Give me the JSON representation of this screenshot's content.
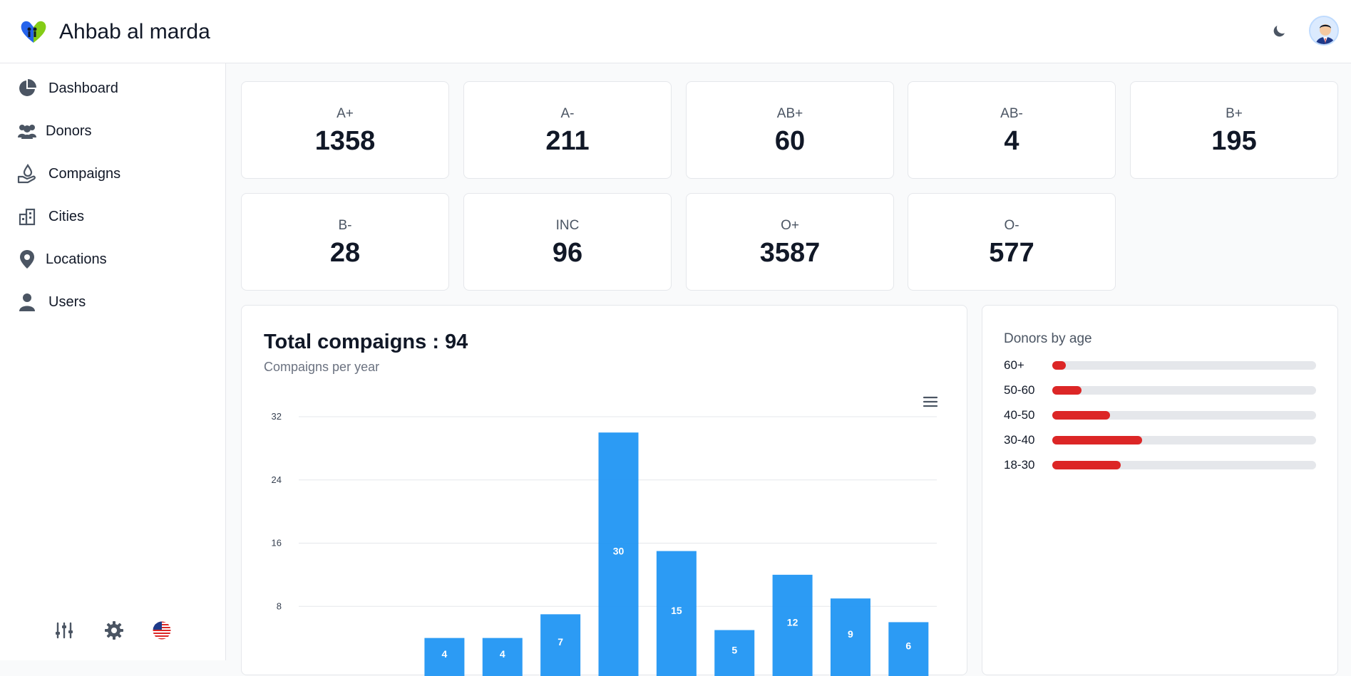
{
  "app": {
    "title": "Ahbab al marda"
  },
  "sidebar": {
    "items": [
      {
        "label": "Dashboard",
        "icon": "pie-chart-icon"
      },
      {
        "label": "Donors",
        "icon": "users-icon"
      },
      {
        "label": "Compaigns",
        "icon": "hand-drop-icon"
      },
      {
        "label": "Cities",
        "icon": "city-icon"
      },
      {
        "label": "Locations",
        "icon": "map-pin-icon"
      },
      {
        "label": "Users",
        "icon": "user-icon"
      }
    ],
    "bottom": [
      "sliders-icon",
      "gear-icon",
      "us-flag-icon"
    ]
  },
  "stats": [
    {
      "label": "A+",
      "value": "1358"
    },
    {
      "label": "A-",
      "value": "211"
    },
    {
      "label": "AB+",
      "value": "60"
    },
    {
      "label": "AB-",
      "value": "4"
    },
    {
      "label": "B+",
      "value": "195"
    },
    {
      "label": "B-",
      "value": "28"
    },
    {
      "label": "INC",
      "value": "96"
    },
    {
      "label": "O+",
      "value": "3587"
    },
    {
      "label": "O-",
      "value": "577"
    }
  ],
  "campaigns": {
    "title": "Total compaigns : 94",
    "subtitle": "Compaigns per year"
  },
  "chart_data": {
    "type": "bar",
    "title": "",
    "xlabel": "",
    "ylabel": "",
    "ylim": [
      0,
      32
    ],
    "yticks": [
      "32",
      "24",
      "16",
      "8"
    ],
    "values": [
      0,
      0,
      4,
      4,
      7,
      30,
      15,
      5,
      12,
      9,
      6
    ],
    "data_labels": [
      "",
      "",
      "4",
      "4",
      "7",
      "30",
      "15",
      "5",
      "12",
      "9",
      "6"
    ],
    "color": "#2196f3",
    "grid": true
  },
  "donors_by_age": {
    "title": "Donors by age",
    "rows": [
      {
        "label": "60+",
        "fraction": 0.05
      },
      {
        "label": "50-60",
        "fraction": 0.11
      },
      {
        "label": "40-50",
        "fraction": 0.22
      },
      {
        "label": "30-40",
        "fraction": 0.34
      },
      {
        "label": "18-30",
        "fraction": 0.26
      }
    ],
    "color": "#dc2626"
  }
}
